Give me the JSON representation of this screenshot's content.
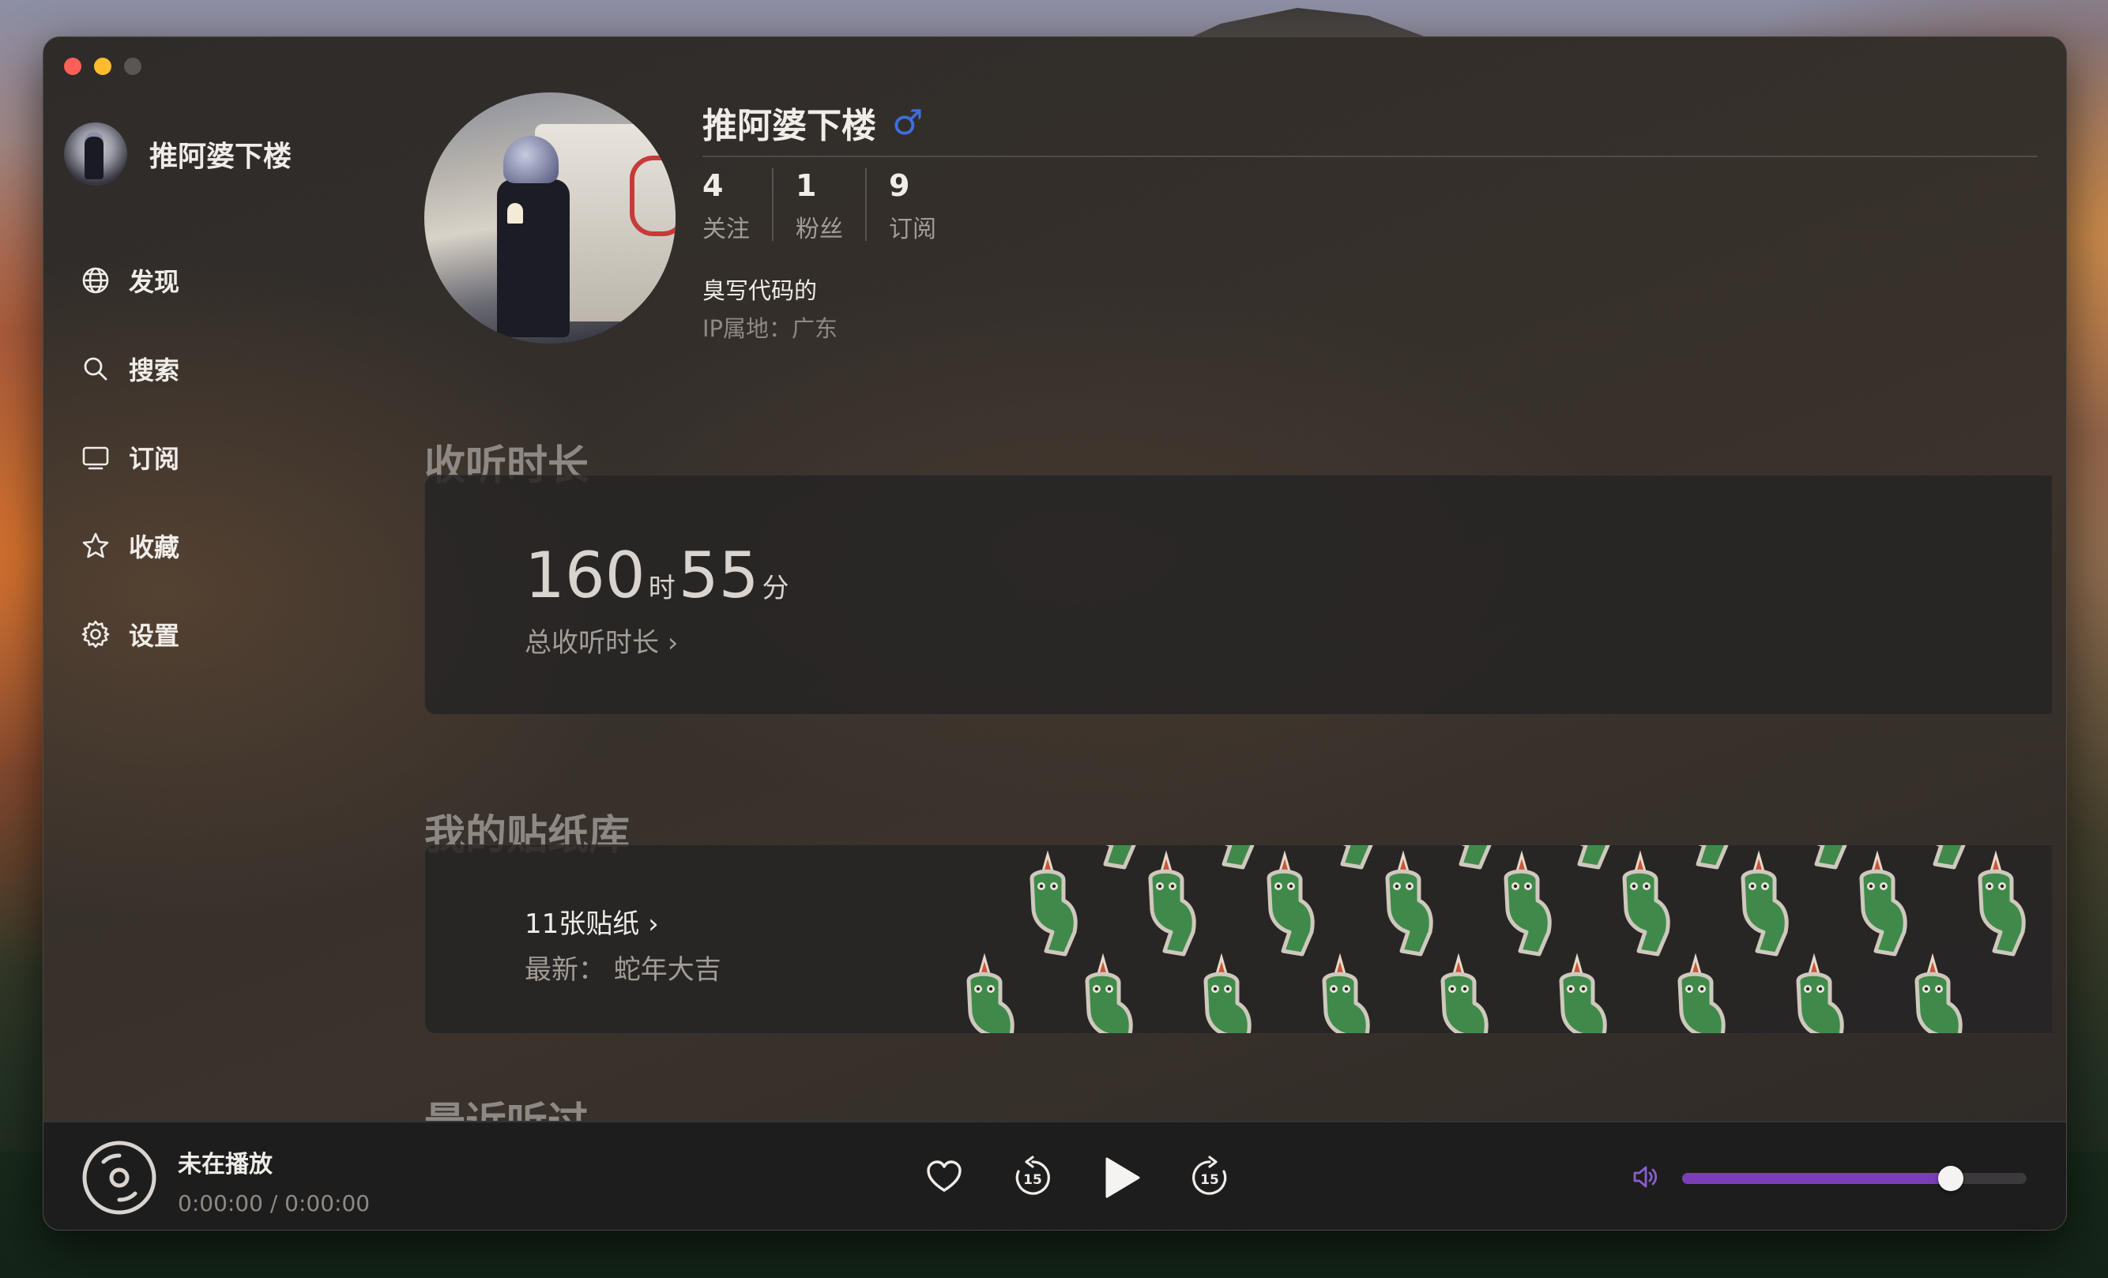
{
  "sidebar": {
    "user_name": "推阿婆下楼",
    "items": [
      {
        "label": "发现",
        "icon": "globe-icon"
      },
      {
        "label": "搜索",
        "icon": "search-icon"
      },
      {
        "label": "订阅",
        "icon": "tv-icon"
      },
      {
        "label": "收藏",
        "icon": "star-icon"
      },
      {
        "label": "设置",
        "icon": "gear-icon"
      }
    ]
  },
  "profile": {
    "name": "推阿婆下楼",
    "gender_symbol": "♂",
    "stats": [
      {
        "value": "4",
        "label": "关注"
      },
      {
        "value": "1",
        "label": "粉丝"
      },
      {
        "value": "9",
        "label": "订阅"
      }
    ],
    "bio": "臭写代码的",
    "ip_location": "IP属地：广东"
  },
  "listening": {
    "section_title": "收听时长",
    "hours": "160",
    "hours_unit": "时",
    "minutes": "55",
    "minutes_unit": "分",
    "total_label": "总收听时长 ›"
  },
  "stickers": {
    "section_title": "我的贴纸库",
    "count_label": "11张贴纸 ›",
    "latest_label": "最新：  蛇年大吉"
  },
  "recent": {
    "section_title": "最近听过"
  },
  "player": {
    "title": "未在播放",
    "time": "0:00:00 / 0:00:00",
    "volume": 0.78,
    "accent_color": "#7a3fb8"
  }
}
